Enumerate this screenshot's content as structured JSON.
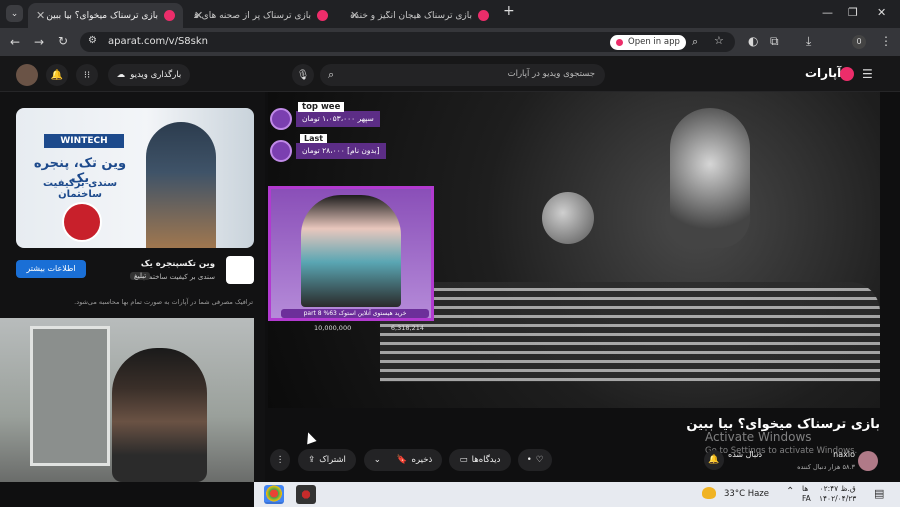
{
  "browser": {
    "tabs": [
      {
        "title": "بازی ترسناک میخوای؟ بیا ببین",
        "active": true
      },
      {
        "title": "بازی ترسناک پر از صحنه های هیجا...",
        "active": false
      },
      {
        "title": "بازی ترسناک هیجان انگیز و خنده دا...",
        "active": false
      }
    ],
    "url": "aparat.com/v/S8skn",
    "open_in_app": "Open in app",
    "profile_badge": "0"
  },
  "site": {
    "logo": "آپارات",
    "search_placeholder": "جستجوی ویدیو در آپارات",
    "upload_label": "بارگذاری ویدیو"
  },
  "ad": {
    "brand": "WINTECH",
    "headline": "وین تک، پنجره یک",
    "subline": "سندی برکیفیت ساختمان",
    "title": "وین تکسپنجره یک",
    "description": "سندی بر کیفیت ساختمان",
    "tag": "تبلیغ",
    "cta": "اطلاعات بیشتر",
    "note": "ترافیک مصرفی شما در آپارات به صورت تمام بها محاسبه می‌شود."
  },
  "stream_overlay": {
    "top_week": "top wee",
    "top_amount": "سپهر ۱،۰۵۳،۰۰۰ تومان",
    "last_label": "Last",
    "last_amount": "[بدون نام] ۲۸،۰۰۰ تومان",
    "goal_text": "خرید هیستوی آنلاین استوک part 8 %63",
    "goal_total": "10,000,000",
    "goal_current": "6,318,214"
  },
  "video": {
    "title": "بازی ترسناک میخوای؟ بیا ببین",
    "channel_name": "naxio",
    "channel_subs": "۵۸.۳ هزار دنبال کننده",
    "follow_label": "دنبال شده",
    "actions": {
      "share": "اشتراک",
      "save": "ذخیره",
      "comments": "دیدگاه‌ها",
      "like_count": "•"
    }
  },
  "watermark": {
    "title": "Activate Windows",
    "subtitle": "Go to Settings to activate Windows."
  },
  "taskbar": {
    "weather": "33°C  Haze",
    "lang": "ها",
    "lang2": "FA",
    "time": "ق.ظ ۰۲:۴۷",
    "date": "۱۴۰۲/۰۴/۲۳"
  },
  "colors": {
    "accent": "#ec2d6a",
    "cta_blue": "#1a6fd6",
    "overlay_purple": "#b23ad0"
  }
}
